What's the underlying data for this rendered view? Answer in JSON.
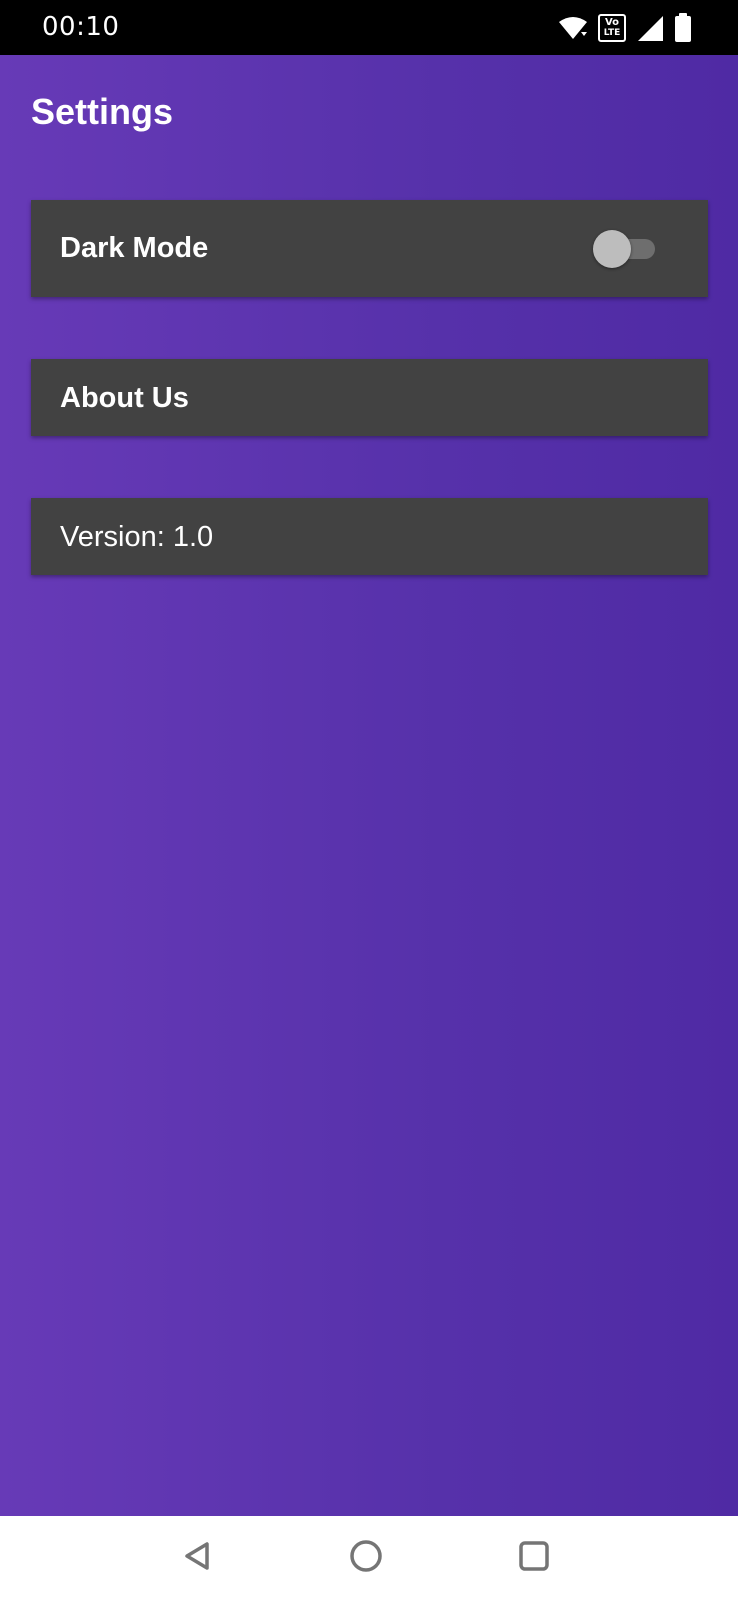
{
  "status_bar": {
    "time": "00:10",
    "volte_top": "Vo",
    "volte_bottom": "LTE",
    "icons": [
      "wifi-icon",
      "volte-icon",
      "signal-icon",
      "battery-icon"
    ]
  },
  "app": {
    "title": "Settings",
    "background_colors": [
      "#673ab7",
      "#4f2aa4"
    ],
    "card_color": "#424242"
  },
  "settings": {
    "dark_mode": {
      "label": "Dark Mode",
      "enabled": false
    },
    "about": {
      "label": "About Us"
    },
    "version": {
      "label": "Version: 1.0"
    }
  },
  "nav_bar": {
    "icons": [
      "back-icon",
      "home-icon",
      "recents-icon"
    ]
  }
}
